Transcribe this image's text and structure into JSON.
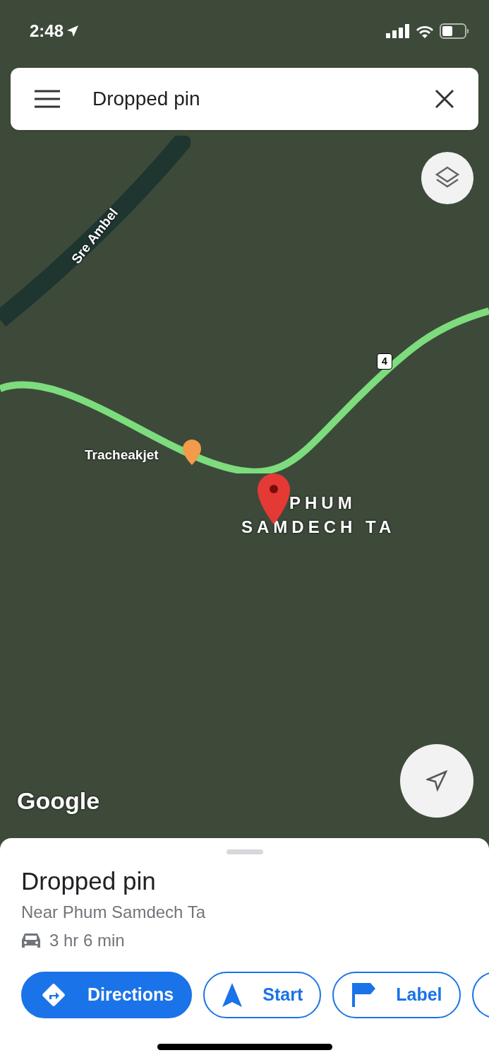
{
  "status_bar": {
    "time": "2:48"
  },
  "search_bar": {
    "value": "Dropped pin"
  },
  "map": {
    "labels": [
      {
        "text": "Sre Ambel",
        "kind": "river"
      },
      {
        "text": "4",
        "kind": "shield"
      },
      {
        "text": "Tracheakjet",
        "kind": "poi"
      },
      {
        "text": "PHUM",
        "kind": "place"
      },
      {
        "text": "SAMDECH TA",
        "kind": "place"
      }
    ],
    "logo": "Google"
  },
  "sheet": {
    "title": "Dropped pin",
    "subtitle": "Near Phum Samdech Ta",
    "travel_time": "3 hr 6 min",
    "actions": [
      {
        "label": "Directions",
        "kind": "primary"
      },
      {
        "label": "Start",
        "kind": "start"
      },
      {
        "label": "Label",
        "kind": "label"
      }
    ]
  }
}
